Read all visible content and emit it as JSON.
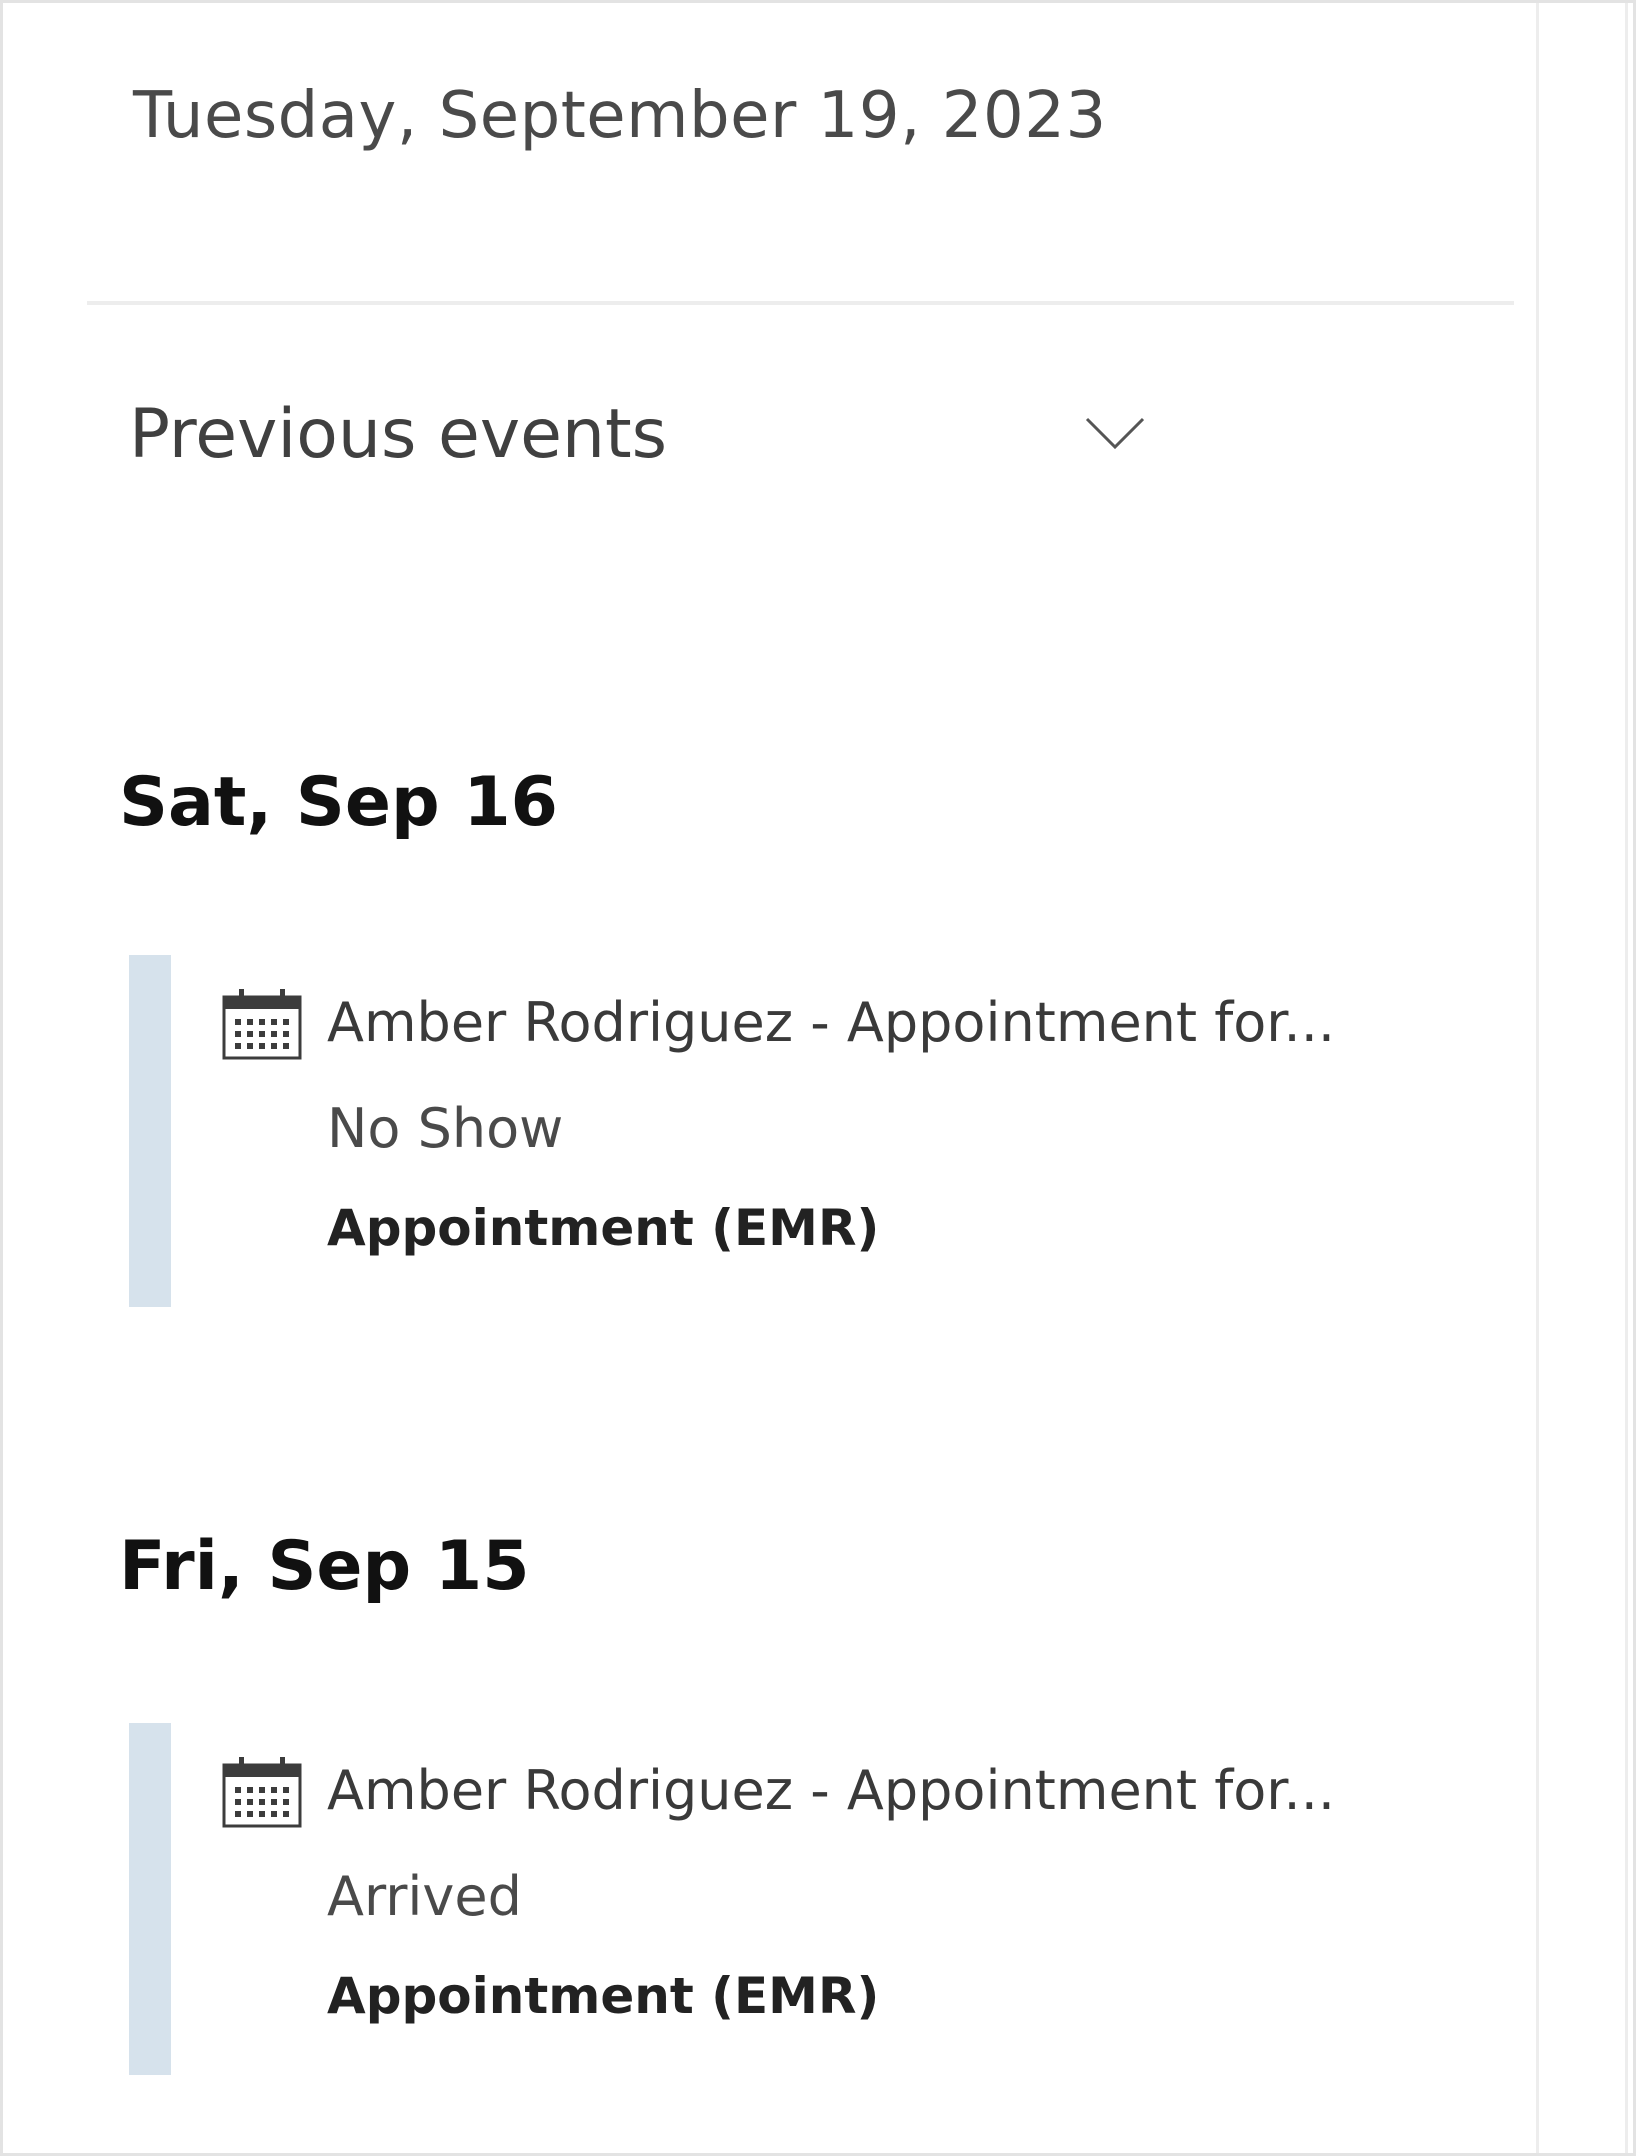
{
  "date_header": "Tuesday, September 19, 2023",
  "previous_events": {
    "label": "Previous events",
    "icon": "chevron-down-icon"
  },
  "days": [
    {
      "heading": "Sat, Sep 16",
      "events": [
        {
          "icon": "calendar-icon",
          "title": "Amber Rodriguez - Appointment for...",
          "status": "No Show",
          "type": "Appointment (EMR)"
        }
      ]
    },
    {
      "heading": "Fri, Sep 15",
      "events": [
        {
          "icon": "calendar-icon",
          "title": "Amber Rodriguez - Appointment for...",
          "status": "Arrived",
          "type": "Appointment (EMR)"
        }
      ]
    }
  ],
  "colors": {
    "event_bar": "#d6e2ec",
    "divider": "#ededed"
  }
}
